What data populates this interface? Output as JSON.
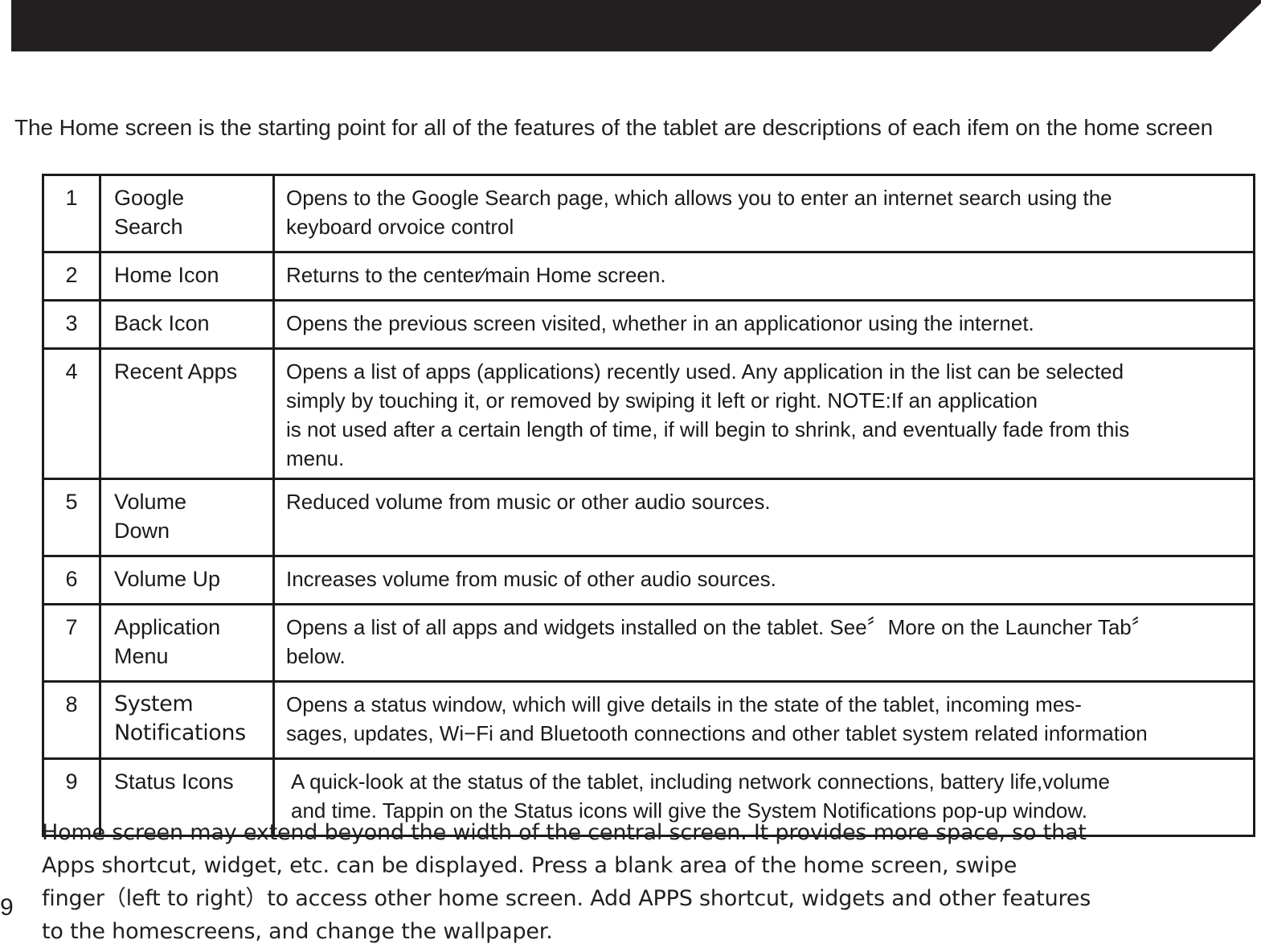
{
  "banner": {
    "name": "decorative-black-banner"
  },
  "intro": "The Home screen is the starting point for all of the features of the tablet are descriptions of each ifem on the home screen",
  "table": {
    "rows": [
      {
        "num": "1",
        "name": "Google\nSearch",
        "desc": "Opens  to  the  Google Search  page, which allows you to enter an internet search using the\nkeyboard  orvoice  control"
      },
      {
        "num": "2",
        "name": "Home  Icon",
        "desc": "Returns  to  the  center∕main Home  screen."
      },
      {
        "num": "3",
        "name": "Back  Icon",
        "desc": "Opens  the  previous  screen  visited,   whether in  an  applicationor  using  the  internet."
      },
      {
        "num": "4",
        "name": "Recent  Apps",
        "desc": "Opens a list of apps (applications) recently used. Any application in the list can be selected\nsimply by touching it, or removed by swiping it left or right. NOTE:If an application\nis not used after a certain length of time, if will begin to shrink, and eventually fade from this\nmenu."
      },
      {
        "num": "5",
        "name": "Volume\nDown",
        "desc": "Reduced volume from music or other audio sources."
      },
      {
        "num": "6",
        "name": "Volume  Up",
        "desc": "Increases  volume  from  music of other audio sources."
      },
      {
        "num": "7",
        "name": "Application\nMenu",
        "desc": "Opens  a  list of all apps and widgets installed on the tablet. See〞More on the Launcher Tab〞\nbelow."
      },
      {
        "num": "8",
        "name": "System\nNotifications",
        "desc": "Opens a status window,  which will give details in the state of the tablet, incoming mes-\nsages, updates, Wi−Fi  and  Bluetooth  connections and other tablet system related information"
      },
      {
        "num": "9",
        "name": "Status  Icons",
        "desc": " A quick-look at  the  status  of  the  tablet,   including network connections, battery life,volume\n and time. Tappin on  the  Status  icons  will  give  the  System Notifications pop-up window."
      }
    ]
  },
  "closing": "Home screen may extend beyond the width of the central  screen. It  provides  more  space, so  that\nApps  shortcut, widget, etc. can be displayed.  Press  a  blank  area  of  the  home  screen, swipe\nfinger（left  to  right）to  access  other  home  screen. Add APPS shortcut, widgets and other features\nto the homescreens, and change the wallpaper.",
  "page_number": "9"
}
